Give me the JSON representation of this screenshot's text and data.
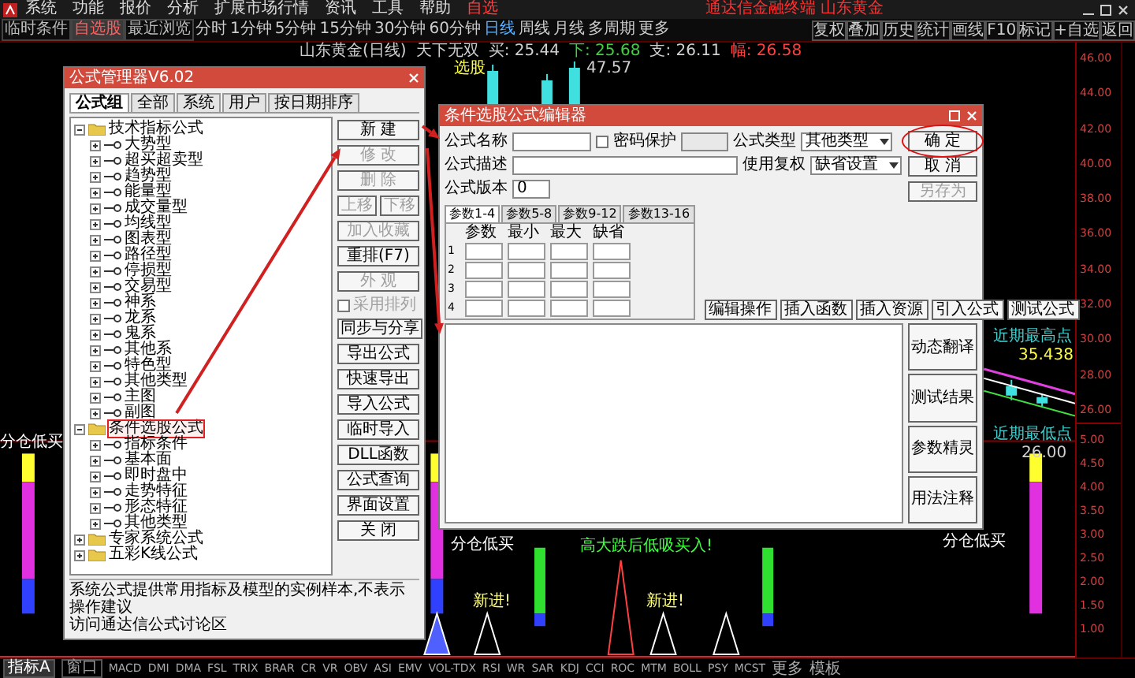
{
  "menu_bar": {
    "items": [
      "系统",
      "功能",
      "报价",
      "分析",
      "扩展市场行情",
      "资讯",
      "工具",
      "帮助"
    ],
    "highlight": "自选",
    "title": "通达信金融终端 山东黄金"
  },
  "toolbar": {
    "tabs": [
      {
        "label": "临时条件",
        "selected": false
      },
      {
        "label": "自选股",
        "selected": true
      },
      {
        "label": "最近浏览",
        "selected": false
      }
    ],
    "periods": [
      {
        "label": "分时",
        "selected": false
      },
      {
        "label": "1分钟",
        "selected": false
      },
      {
        "label": "5分钟",
        "selected": false
      },
      {
        "label": "15分钟",
        "selected": false
      },
      {
        "label": "30分钟",
        "selected": false
      },
      {
        "label": "60分钟",
        "selected": false
      },
      {
        "label": "日线",
        "selected": true
      },
      {
        "label": "周线",
        "selected": false
      },
      {
        "label": "月线",
        "selected": false
      },
      {
        "label": "多周期",
        "selected": false
      },
      {
        "label": "更多",
        "selected": false
      }
    ],
    "actions": [
      "复权",
      "叠加",
      "历史",
      "统计",
      "画线",
      "F10",
      "标记",
      "+自选",
      "返回"
    ]
  },
  "chart": {
    "info": [
      {
        "text": "山东黄金(日线)",
        "color": "#d0d0d0"
      },
      {
        "text": "天下无双",
        "color": "#d0d0d0"
      },
      {
        "text": "买: 25.44",
        "color": "#d0d0d0"
      },
      {
        "text": "下: 25.68",
        "color": "#40d040"
      },
      {
        "text": "支: 26.11",
        "color": "#d0d0d0"
      },
      {
        "text": "幅: 26.58",
        "color": "#ff4040"
      }
    ],
    "labels": [
      {
        "text": "选股",
        "color": "#ffff40"
      },
      {
        "text": "47.57",
        "color": "#d0d0d0"
      },
      {
        "text": "近期最高点",
        "color": "#40d0d0"
      },
      {
        "text": "35.438",
        "color": "#ffff40"
      },
      {
        "text": "近期最低点",
        "color": "#40d0d0"
      },
      {
        "text": "26.00",
        "color": "#d0d0d0"
      },
      {
        "text": "分仓低买",
        "color": "#ffffff"
      },
      {
        "text": "分仓低买",
        "color": "#ffffff"
      },
      {
        "text": "分仓低买",
        "color": "#ffffff"
      },
      {
        "text": "新进!",
        "color": "#ffff80"
      },
      {
        "text": "高大跌后低吸买入!",
        "color": "#40ff40"
      },
      {
        "text": "新进!",
        "color": "#ffff80"
      }
    ],
    "price_axis": {
      "upper": [
        "46.00",
        "44.00",
        "42.00",
        "40.00",
        "38.00",
        "36.00",
        "34.00",
        "32.00",
        "30.00",
        "28.00",
        "26.00"
      ],
      "lower": [
        "5.00",
        "4.50",
        "4.00",
        "3.50",
        "3.00",
        "2.50",
        "2.00",
        "1.50",
        "1.00"
      ]
    }
  },
  "formula_manager": {
    "title": "公式管理器V6.02",
    "tabs": [
      {
        "label": "公式组",
        "selected": true
      },
      {
        "label": "全部",
        "selected": false
      },
      {
        "label": "系统",
        "selected": false
      },
      {
        "label": "用户",
        "selected": false
      },
      {
        "label": "按日期排序",
        "selected": false
      }
    ],
    "tree": [
      {
        "label": "技术指标公式",
        "kind": "folder",
        "expanded": true,
        "selected": false,
        "children": [
          {
            "label": "大势型",
            "kind": "group",
            "expanded": false,
            "selected": false
          },
          {
            "label": "超买超卖型",
            "kind": "group",
            "expanded": false,
            "selected": false
          },
          {
            "label": "趋势型",
            "kind": "group",
            "expanded": false,
            "selected": false
          },
          {
            "label": "能量型",
            "kind": "group",
            "expanded": false,
            "selected": false
          },
          {
            "label": "成交量型",
            "kind": "group",
            "expanded": false,
            "selected": false
          },
          {
            "label": "均线型",
            "kind": "group",
            "expanded": false,
            "selected": false
          },
          {
            "label": "图表型",
            "kind": "group",
            "expanded": false,
            "selected": false
          },
          {
            "label": "路径型",
            "kind": "group",
            "expanded": false,
            "selected": false
          },
          {
            "label": "停损型",
            "kind": "group",
            "expanded": false,
            "selected": false
          },
          {
            "label": "交易型",
            "kind": "group",
            "expanded": false,
            "selected": false
          },
          {
            "label": "神系",
            "kind": "group",
            "expanded": false,
            "selected": false
          },
          {
            "label": "龙系",
            "kind": "group",
            "expanded": false,
            "selected": false
          },
          {
            "label": "鬼系",
            "kind": "group",
            "expanded": false,
            "selected": false
          },
          {
            "label": "其他系",
            "kind": "group",
            "expanded": false,
            "selected": false
          },
          {
            "label": "特色型",
            "kind": "group",
            "expanded": false,
            "selected": false
          },
          {
            "label": "其他类型",
            "kind": "group",
            "expanded": false,
            "selected": false
          },
          {
            "label": "主图",
            "kind": "group",
            "expanded": false,
            "selected": false
          },
          {
            "label": "副图",
            "kind": "group",
            "expanded": false,
            "selected": false
          }
        ]
      },
      {
        "label": "条件选股公式",
        "kind": "folder",
        "expanded": true,
        "selected": true,
        "children": [
          {
            "label": "指标条件",
            "kind": "group",
            "expanded": false,
            "selected": false
          },
          {
            "label": "基本面",
            "kind": "group",
            "expanded": false,
            "selected": false
          },
          {
            "label": "即时盘中",
            "kind": "group",
            "expanded": false,
            "selected": false
          },
          {
            "label": "走势特征",
            "kind": "group",
            "expanded": false,
            "selected": false
          },
          {
            "label": "形态特征",
            "kind": "group",
            "expanded": false,
            "selected": false
          },
          {
            "label": "其他类型",
            "kind": "group",
            "expanded": false,
            "selected": false
          }
        ]
      },
      {
        "label": "专家系统公式",
        "kind": "folder",
        "expanded": false,
        "selected": false
      },
      {
        "label": "五彩K线公式",
        "kind": "folder",
        "expanded": false,
        "selected": false
      }
    ],
    "buttons": [
      [
        {
          "label": "新 建",
          "kind": "button",
          "disabled": false
        }
      ],
      [
        {
          "label": "修 改",
          "kind": "button",
          "disabled": true
        }
      ],
      [
        {
          "label": "删 除",
          "kind": "button",
          "disabled": true
        }
      ],
      [
        {
          "label": "上移",
          "kind": "button",
          "disabled": true
        },
        {
          "label": "下移",
          "kind": "button",
          "disabled": true
        }
      ],
      [
        {
          "label": "加入收藏",
          "kind": "button",
          "disabled": true
        }
      ],
      [
        {
          "label": "重排(F7)",
          "kind": "button",
          "disabled": false
        }
      ],
      [
        {
          "label": "外 观",
          "kind": "button",
          "disabled": true
        }
      ],
      [
        {
          "label": "采用排列",
          "kind": "checkbox",
          "disabled": true,
          "checked": false
        }
      ],
      [
        {
          "label": "同步与分享",
          "kind": "button",
          "disabled": false
        }
      ],
      [
        {
          "label": "导出公式",
          "kind": "button",
          "disabled": false
        }
      ],
      [
        {
          "label": "快速导出",
          "kind": "button",
          "disabled": false
        }
      ],
      [
        {
          "label": "导入公式",
          "kind": "button",
          "disabled": false
        }
      ],
      [
        {
          "label": "临时导入",
          "kind": "button",
          "disabled": false
        }
      ],
      [
        {
          "label": "DLL函数",
          "kind": "button",
          "disabled": false
        }
      ],
      [
        {
          "label": "公式查询",
          "kind": "button",
          "disabled": false
        }
      ],
      [
        {
          "label": "界面设置",
          "kind": "button",
          "disabled": false
        }
      ],
      [
        {
          "label": "关 闭",
          "kind": "button",
          "disabled": false
        }
      ]
    ],
    "status": "系统公式提供常用指标及模型的实例样本,不表示操作建议",
    "link": "访问通达信公式讨论区"
  },
  "formula_editor": {
    "title": "条件选股公式编辑器",
    "name": {
      "label": "公式名称"
    },
    "password": {
      "label": "密码保护",
      "checked": false
    },
    "type": {
      "label": "公式类型",
      "value": "其他类型"
    },
    "description": {
      "label": "公式描述"
    },
    "rights": {
      "label": "使用复权",
      "value": "缺省设置"
    },
    "version": {
      "label": "公式版本",
      "value": "0"
    },
    "side_buttons": [
      {
        "label": "确 定",
        "highlighted": true,
        "disabled": false
      },
      {
        "label": "取 消",
        "highlighted": false,
        "disabled": false
      },
      {
        "label": "另存为",
        "highlighted": false,
        "disabled": true
      }
    ],
    "param_tabs": [
      {
        "label": "参数1-4",
        "selected": true
      },
      {
        "label": "参数5-8",
        "selected": false
      },
      {
        "label": "参数9-12",
        "selected": false
      },
      {
        "label": "参数13-16",
        "selected": false
      }
    ],
    "param_columns": [
      "参数",
      "最小",
      "最大",
      "缺省"
    ],
    "param_rows": [
      "1",
      "2",
      "3",
      "4"
    ],
    "tool_buttons": [
      "编辑操作",
      "插入函数",
      "插入资源",
      "引入公式",
      "测试公式"
    ],
    "bottom_buttons": [
      "动态翻译",
      "测试结果",
      "参数精灵",
      "用法注释"
    ]
  },
  "indicator_bar": {
    "window_tabs": [
      {
        "label": "指标A",
        "selected": true
      },
      {
        "label": "窗口",
        "selected": false
      }
    ],
    "indicators": [
      "MACD",
      "DMI",
      "DMA",
      "FSL",
      "TRIX",
      "BRAR",
      "CR",
      "VR",
      "OBV",
      "ASI",
      "EMV",
      "VOL-TDX",
      "RSI",
      "WR",
      "SAR",
      "KDJ",
      "CCI",
      "ROC",
      "MTM",
      "BOLL",
      "PSY",
      "MCST"
    ],
    "extras": [
      "更多",
      "模板"
    ]
  }
}
